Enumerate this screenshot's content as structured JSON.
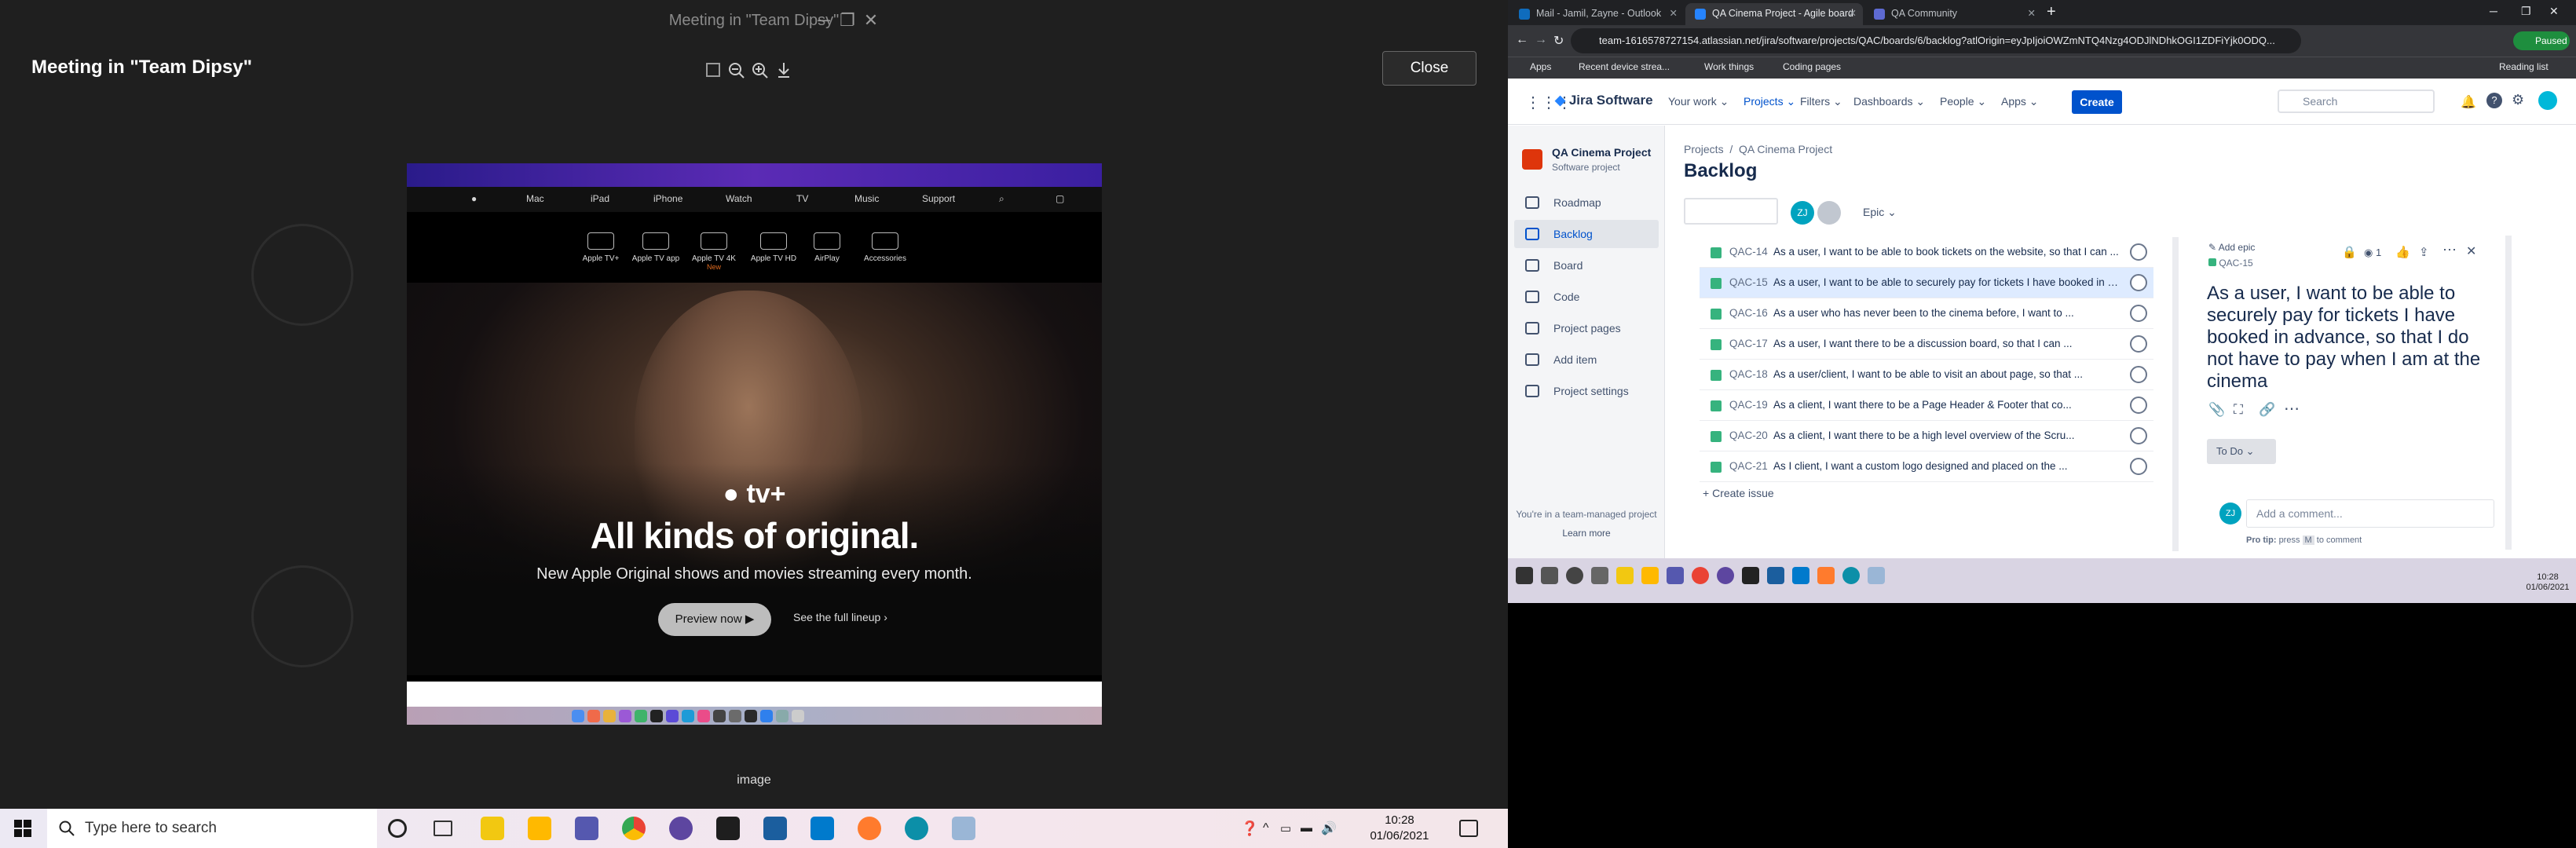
{
  "teams": {
    "window_title": "Meeting in \"Team Dipsy\"",
    "meeting_title": "Meeting in \"Team Dipsy\"",
    "close_label": "Close",
    "image_caption": "image"
  },
  "shared_image": {
    "nav": [
      "Mac",
      "iPad",
      "iPhone",
      "Watch",
      "TV",
      "Music",
      "Support"
    ],
    "tv_items": [
      "Apple TV+",
      "Apple TV app",
      "Apple TV 4K",
      "Apple TV HD",
      "AirPlay",
      "Accessories"
    ],
    "tv_new_badge": "New",
    "logo": "tv+",
    "headline": "All kinds of original.",
    "subhead": "New Apple Original shows and movies streaming every month.",
    "preview_button": "Preview now",
    "lineup_link": "See the full lineup"
  },
  "browser": {
    "tabs": [
      "Mail - Jamil, Zayne - Outlook",
      "QA Cinema Project - Agile board",
      "QA Community"
    ],
    "url": "team-1616578727154.atlassian.net/jira/software/projects/QAC/boards/6/backlog?atlOrigin=eyJpIjoiOWZmNTQ4Nzg4ODJlNDhkOGI1ZDFiYjk0ODQ...",
    "paused_label": "Paused",
    "bookmarks": [
      "Apps",
      "Recent device strea...",
      "Work things",
      "Coding pages"
    ],
    "reading_list": "Reading list"
  },
  "jira": {
    "product": "Jira Software",
    "nav": [
      "Your work",
      "Projects",
      "Filters",
      "Dashboards",
      "People",
      "Apps"
    ],
    "create_label": "Create",
    "search_placeholder": "Search",
    "project_name": "QA Cinema Project",
    "project_type": "Software project",
    "sidebar": [
      "Roadmap",
      "Backlog",
      "Board",
      "Code",
      "Project pages",
      "Add item",
      "Project settings"
    ],
    "sidebar_footer": "You're in a team-managed project",
    "learn_more": "Learn more",
    "breadcrumb_projects": "Projects",
    "breadcrumb_project": "QA Cinema Project",
    "page_title": "Backlog",
    "epic_filter": "Epic",
    "issues": [
      {
        "key": "QAC-14",
        "summary": "As a user, I want to be able to book tickets on the website, so that I can ..."
      },
      {
        "key": "QAC-15",
        "summary": "As a user, I want to be able to securely pay for tickets I have booked in advance"
      },
      {
        "key": "QAC-16",
        "summary": "As a user who has never been to the cinema before, I want to ..."
      },
      {
        "key": "QAC-17",
        "summary": "As a user, I want there to be a discussion board, so that I can ..."
      },
      {
        "key": "QAC-18",
        "summary": "As a user/client, I want to be able to visit an about page, so that ..."
      },
      {
        "key": "QAC-19",
        "summary": "As a client, I want there to be a Page Header & Footer that co..."
      },
      {
        "key": "QAC-20",
        "summary": "As a client, I want there to be a high level overview of the Scru..."
      },
      {
        "key": "QAC-21",
        "summary": "As I client, I want a custom logo designed and placed on the ..."
      }
    ],
    "create_issue": "Create issue",
    "detail": {
      "add_epic": "Add epic",
      "key": "QAC-15",
      "watchers": "1",
      "title": "As a user, I want to be able to securely pay for tickets I have booked in advance, so that I do not have to pay when I am at the cinema",
      "status": "To Do",
      "comment_placeholder": "Add a comment...",
      "protip": "Pro tip:",
      "protip_press": "press",
      "protip_key": "M",
      "protip_rest": "to comment"
    }
  },
  "inner_clock": {
    "time": "10:28",
    "date": "01/06/2021"
  },
  "taskbar": {
    "search_placeholder": "Type here to search",
    "time": "10:28",
    "date": "01/06/2021"
  }
}
